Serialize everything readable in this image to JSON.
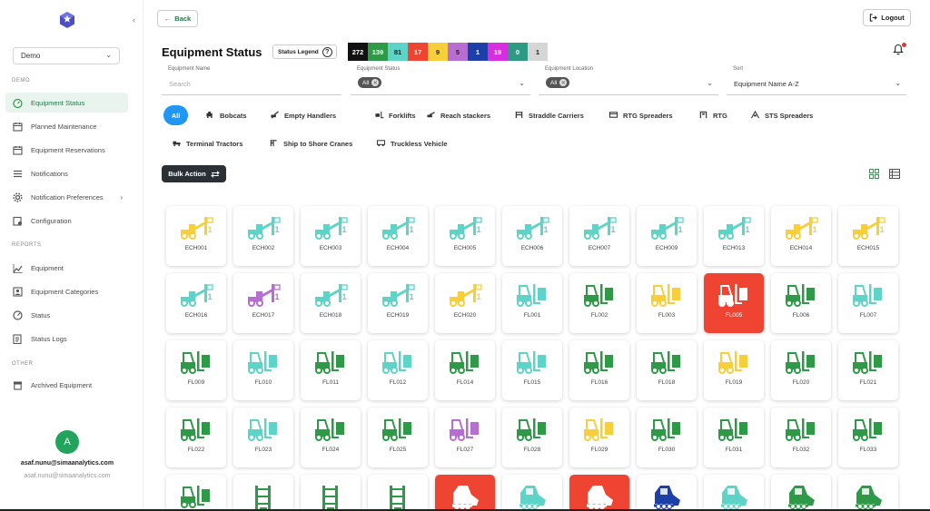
{
  "sidebar": {
    "org": "Demo",
    "sections": [
      {
        "label": "DEMO",
        "items": [
          {
            "label": "Equipment Status",
            "icon": "gauge-icon",
            "active": true
          },
          {
            "label": "Planned Maintenance",
            "icon": "calendar-wrench-icon"
          },
          {
            "label": "Equipment Reservations",
            "icon": "calendar-icon"
          },
          {
            "label": "Notifications",
            "icon": "list-icon"
          },
          {
            "label": "Notification Preferences",
            "icon": "gear-icon",
            "chevron": true
          },
          {
            "label": "Configuration",
            "icon": "config-icon"
          }
        ]
      },
      {
        "label": "REPORTS",
        "items": [
          {
            "label": "Equipment",
            "icon": "chart-icon"
          },
          {
            "label": "Equipment Categories",
            "icon": "category-icon"
          },
          {
            "label": "Status",
            "icon": "status-icon"
          },
          {
            "label": "Status Logs",
            "icon": "log-icon"
          }
        ]
      },
      {
        "label": "OTHER",
        "items": [
          {
            "label": "Archived Equipment",
            "icon": "archive-icon"
          }
        ]
      }
    ],
    "user": {
      "initial": "A",
      "name": "asaf.nunu@simaanalytics.com",
      "email": "asaf.nunu@simaanalytics.com"
    }
  },
  "header": {
    "back_label": "Back",
    "logout_label": "Logout",
    "title": "Equipment Status",
    "legend_label": "Status Legend",
    "legend_icon": "?",
    "status_counts": [
      {
        "value": "272",
        "bg": "#111111",
        "fg": "#ffffff"
      },
      {
        "value": "139",
        "bg": "#2e9a47",
        "fg": "#ffffff"
      },
      {
        "value": "81",
        "bg": "#5ed3c8",
        "fg": "#222222"
      },
      {
        "value": "17",
        "bg": "#f04433",
        "fg": "#ffffff"
      },
      {
        "value": "9",
        "bg": "#f6cf3a",
        "fg": "#222222"
      },
      {
        "value": "5",
        "bg": "#b66fd1",
        "fg": "#222222"
      },
      {
        "value": "1",
        "bg": "#1d3fa8",
        "fg": "#ffffff"
      },
      {
        "value": "19",
        "bg": "#d92ee0",
        "fg": "#ffffff"
      },
      {
        "value": "0",
        "bg": "#2e9a84",
        "fg": "#ffffff"
      },
      {
        "value": "1",
        "bg": "#d6d6d6",
        "fg": "#222222"
      }
    ]
  },
  "filters": {
    "name": {
      "label": "Equipment Name",
      "placeholder": "Search"
    },
    "status": {
      "label": "Equipment Status",
      "chip": "All"
    },
    "location": {
      "label": "Equipment Location",
      "chip": "All"
    },
    "sort": {
      "label": "Sort",
      "value": "Equipment Name A-Z"
    }
  },
  "categories": [
    "All",
    "Bobcats",
    "Empty Handlers",
    "Forklifts",
    "Reach stackers",
    "Straddle Carriers",
    "RTG Spreaders",
    "RTG",
    "STS Spreaders",
    "Terminal Tractors",
    "Ship to Shore Cranes",
    "Truckless Vehicle"
  ],
  "bulk_action_label": "Bulk Action",
  "colors": {
    "green": "#2e9a47",
    "teal": "#5ed3c8",
    "yellow": "#f6cf3a",
    "red": "#f04433",
    "purple": "#b66fd1",
    "blue": "#1d3fa8",
    "accent": "#2196f3"
  },
  "tiles": [
    [
      {
        "label": "ECH001",
        "type": "handler",
        "status": "yellow"
      },
      {
        "label": "ECH002",
        "type": "handler",
        "status": "teal"
      },
      {
        "label": "ECH003",
        "type": "handler",
        "status": "teal"
      },
      {
        "label": "ECH004",
        "type": "handler",
        "status": "teal"
      },
      {
        "label": "ECH005",
        "type": "handler",
        "status": "teal"
      },
      {
        "label": "ECH006",
        "type": "handler",
        "status": "teal"
      },
      {
        "label": "ECH007",
        "type": "handler",
        "status": "teal"
      },
      {
        "label": "ECH009",
        "type": "handler",
        "status": "teal"
      },
      {
        "label": "ECH013",
        "type": "handler",
        "status": "teal"
      },
      {
        "label": "ECH014",
        "type": "handler",
        "status": "yellow"
      },
      {
        "label": "ECH015",
        "type": "handler",
        "status": "yellow"
      }
    ],
    [
      {
        "label": "ECH016",
        "type": "handler",
        "status": "teal"
      },
      {
        "label": "ECH017",
        "type": "handler",
        "status": "purple"
      },
      {
        "label": "ECH018",
        "type": "handler",
        "status": "teal"
      },
      {
        "label": "ECH019",
        "type": "handler",
        "status": "teal"
      },
      {
        "label": "ECH020",
        "type": "handler",
        "status": "yellow"
      },
      {
        "label": "FL001",
        "type": "forklift",
        "status": "teal"
      },
      {
        "label": "FL002",
        "type": "forklift",
        "status": "green"
      },
      {
        "label": "FL003",
        "type": "forklift",
        "status": "yellow"
      },
      {
        "label": "FL005",
        "type": "forklift",
        "status": "red"
      },
      {
        "label": "FL006",
        "type": "forklift",
        "status": "green"
      },
      {
        "label": "FL007",
        "type": "forklift",
        "status": "teal"
      }
    ],
    [
      {
        "label": "FL009",
        "type": "forklift",
        "status": "green"
      },
      {
        "label": "FL010",
        "type": "forklift",
        "status": "teal"
      },
      {
        "label": "FL011",
        "type": "forklift",
        "status": "green"
      },
      {
        "label": "FL012",
        "type": "forklift",
        "status": "teal"
      },
      {
        "label": "FL014",
        "type": "forklift",
        "status": "green"
      },
      {
        "label": "FL015",
        "type": "forklift",
        "status": "teal"
      },
      {
        "label": "FL016",
        "type": "forklift",
        "status": "green"
      },
      {
        "label": "FL018",
        "type": "forklift",
        "status": "green"
      },
      {
        "label": "FL019",
        "type": "forklift",
        "status": "yellow"
      },
      {
        "label": "FL020",
        "type": "forklift",
        "status": "green"
      },
      {
        "label": "FL021",
        "type": "forklift",
        "status": "green"
      }
    ],
    [
      {
        "label": "FL022",
        "type": "forklift",
        "status": "green"
      },
      {
        "label": "FL023",
        "type": "forklift",
        "status": "teal"
      },
      {
        "label": "FL024",
        "type": "forklift",
        "status": "green"
      },
      {
        "label": "FL025",
        "type": "forklift",
        "status": "green"
      },
      {
        "label": "FL027",
        "type": "forklift",
        "status": "purple"
      },
      {
        "label": "FL028",
        "type": "forklift",
        "status": "green"
      },
      {
        "label": "FL029",
        "type": "forklift",
        "status": "yellow"
      },
      {
        "label": "FL030",
        "type": "forklift",
        "status": "green"
      },
      {
        "label": "FL031",
        "type": "forklift",
        "status": "green"
      },
      {
        "label": "FL032",
        "type": "forklift",
        "status": "green"
      },
      {
        "label": "FL033",
        "type": "forklift",
        "status": "green"
      }
    ],
    [
      {
        "label": "",
        "type": "forklift",
        "status": "green"
      },
      {
        "label": "",
        "type": "reach",
        "status": "green"
      },
      {
        "label": "",
        "type": "reach",
        "status": "green"
      },
      {
        "label": "",
        "type": "reach",
        "status": "green"
      },
      {
        "label": "",
        "type": "bobcat",
        "status": "red"
      },
      {
        "label": "",
        "type": "bobcat",
        "status": "teal"
      },
      {
        "label": "",
        "type": "bobcat",
        "status": "red"
      },
      {
        "label": "",
        "type": "bobcat",
        "status": "blue"
      },
      {
        "label": "",
        "type": "bobcat",
        "status": "teal"
      },
      {
        "label": "",
        "type": "bobcat",
        "status": "green"
      },
      {
        "label": "",
        "type": "bobcat",
        "status": "green"
      }
    ]
  ]
}
